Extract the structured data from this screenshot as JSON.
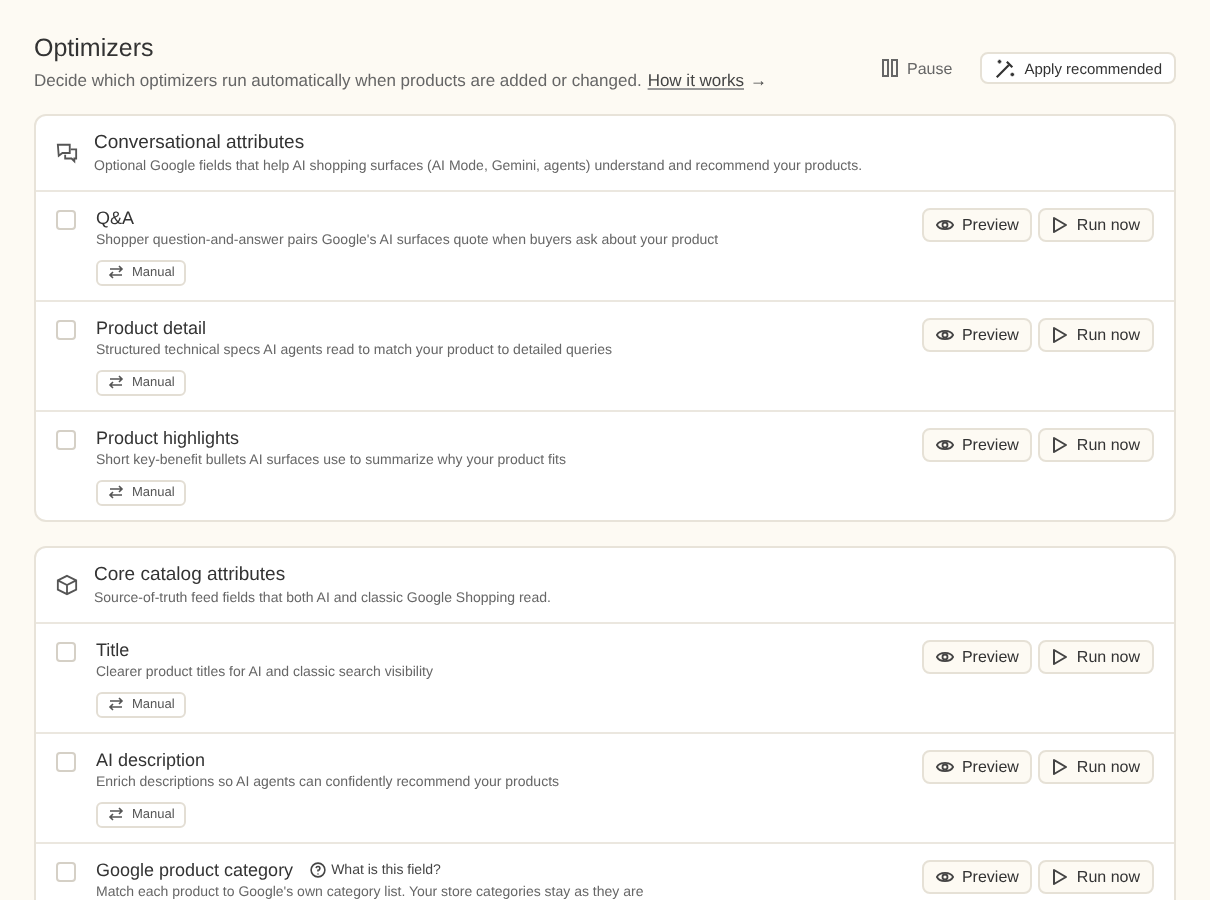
{
  "header": {
    "title": "Optimizers",
    "description": "Decide which optimizers run automatically when products are added or changed.",
    "link": "How it works",
    "link_arrow": "→",
    "actions": [
      {
        "kind": "pause",
        "label": "Pause"
      },
      {
        "kind": "apply",
        "label": "Apply recommended"
      }
    ]
  },
  "sections": [
    {
      "title": "Conversational attributes",
      "description": "Optional Google fields that help AI shopping surfaces (AI Mode, Gemini, agents) understand and recommend your products.",
      "items": [
        {
          "name": "Q&A",
          "description": "Shopper question-and-answer pairs Google's AI surfaces quote when buyers ask about your product",
          "mode": "Manual",
          "checked": false,
          "preview": "Preview",
          "run": "Run now"
        },
        {
          "name": "Product detail",
          "description": "Structured technical specs AI agents read to match your product to detailed queries",
          "mode": "Manual",
          "checked": false,
          "preview": "Preview",
          "run": "Run now"
        },
        {
          "name": "Product highlights",
          "description": "Short key-benefit bullets AI surfaces use to summarize why your product fits",
          "mode": "Manual",
          "checked": false,
          "preview": "Preview",
          "run": "Run now"
        }
      ]
    },
    {
      "title": "Core catalog attributes",
      "description": "Source-of-truth feed fields that both AI and classic Google Shopping read.",
      "items": [
        {
          "name": "Title",
          "description": "Clearer product titles for AI and classic search visibility",
          "mode": "Manual",
          "checked": false,
          "preview": "Preview",
          "run": "Run now"
        },
        {
          "name": "AI description",
          "description": "Enrich descriptions so AI agents can confidently recommend your products",
          "mode": "Manual",
          "checked": false,
          "preview": "Preview",
          "run": "Run now"
        },
        {
          "name": "Google product category",
          "help": "What is this field?",
          "description": "Match each product to Google's own category list. Your store categories stay as they are",
          "checked": false,
          "preview": "Preview",
          "run": "Run now"
        }
      ]
    }
  ]
}
